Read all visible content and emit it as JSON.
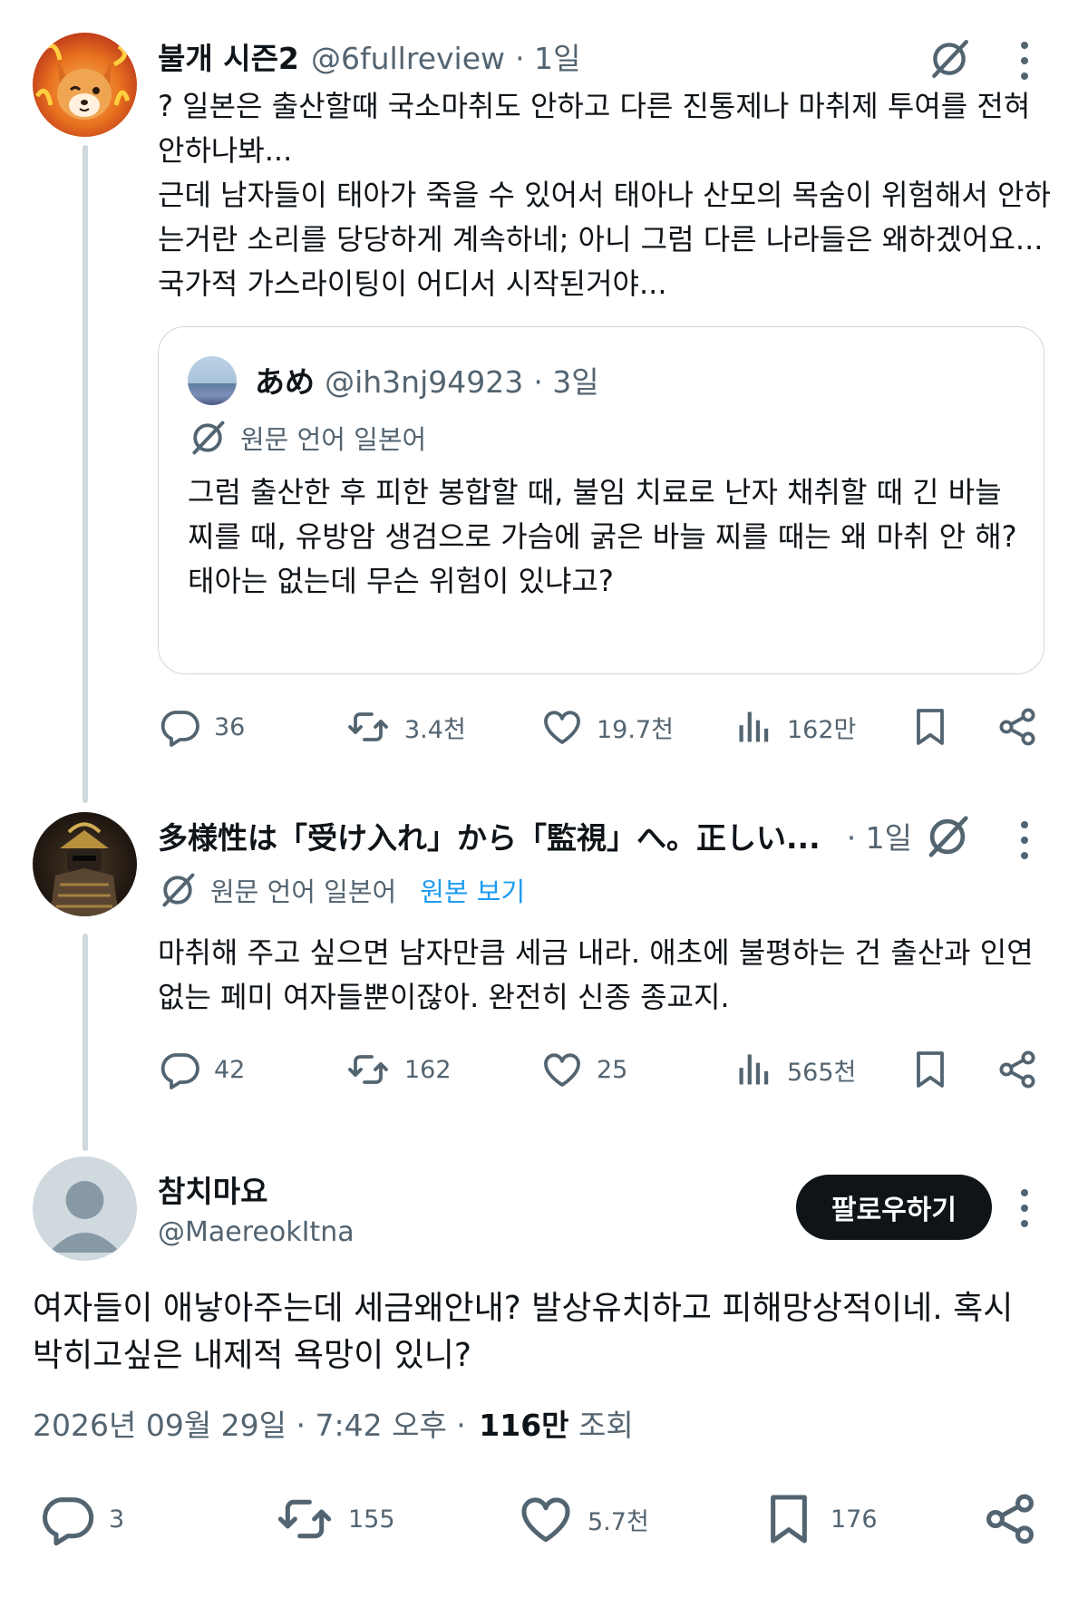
{
  "tweets": [
    {
      "author_name": "불개 시즌2",
      "handle": "@6fullreview",
      "time": "· 1일",
      "text": "? 일본은 출산할때 국소마취도 안하고 다른 진통제나 마취제 투여를 전혀 안하나봐...\n근데 남자들이 태아가 죽을 수 있어서 태아나 산모의 목숨이 위험해서 안하는거란 소리를 당당하게 계속하네; 아니 그럼 다른 나라들은 왜하겠어요... 국가적 가스라이팅이 어디서 시작된거야...",
      "quote": {
        "author_name": "あめ",
        "handle": "@ih3nj94923",
        "time": "· 3일",
        "translation_note": "원문 언어 일본어",
        "text": "그럼 출산한 후 피한 봉합할 때, 불임 치료로 난자 채취할 때 긴 바늘 찌를 때, 유방암 생검으로 가슴에 굵은 바늘 찌를 때는 왜 마취 안 해?\n태아는 없는데 무슨 위험이 있냐고?"
      },
      "stats": {
        "replies": "36",
        "retweets": "3.4천",
        "likes": "19.7천",
        "views": "162만"
      }
    },
    {
      "author_name": "多様性は「受け入れ」から「監視」へ。正しい...",
      "time": "· 1일",
      "translation_note": "원문 언어 일본어",
      "show_original": "원본 보기",
      "text": "마취해 주고 싶으면 남자만큼 세금 내라. 애초에 불평하는 건 출산과 인연 없는 페미 여자들뿐이잖아. 완전히 신종 종교지.",
      "stats": {
        "replies": "42",
        "retweets": "162",
        "likes": "25",
        "views": "565천"
      }
    }
  ],
  "main_tweet": {
    "author_name": "참치마요",
    "handle": "@MaereokItna",
    "follow_label": "팔로우하기",
    "text": "여자들이 애낳아주는데 세금왜안내? 발상유치하고 피해망상적이네. 혹시 박히고싶은 내제적 욕망이 있니?",
    "date": "2026년 09월 29일 · 7:42 오후 ·",
    "views_count": "116만",
    "views_label": "조회",
    "stats": {
      "replies": "3",
      "retweets": "155",
      "likes": "5.7천",
      "bookmarks": "176"
    }
  },
  "colors": {
    "text": "#0f1419",
    "muted": "#536471",
    "link": "#1d9bf0",
    "border": "#cfd9de"
  }
}
